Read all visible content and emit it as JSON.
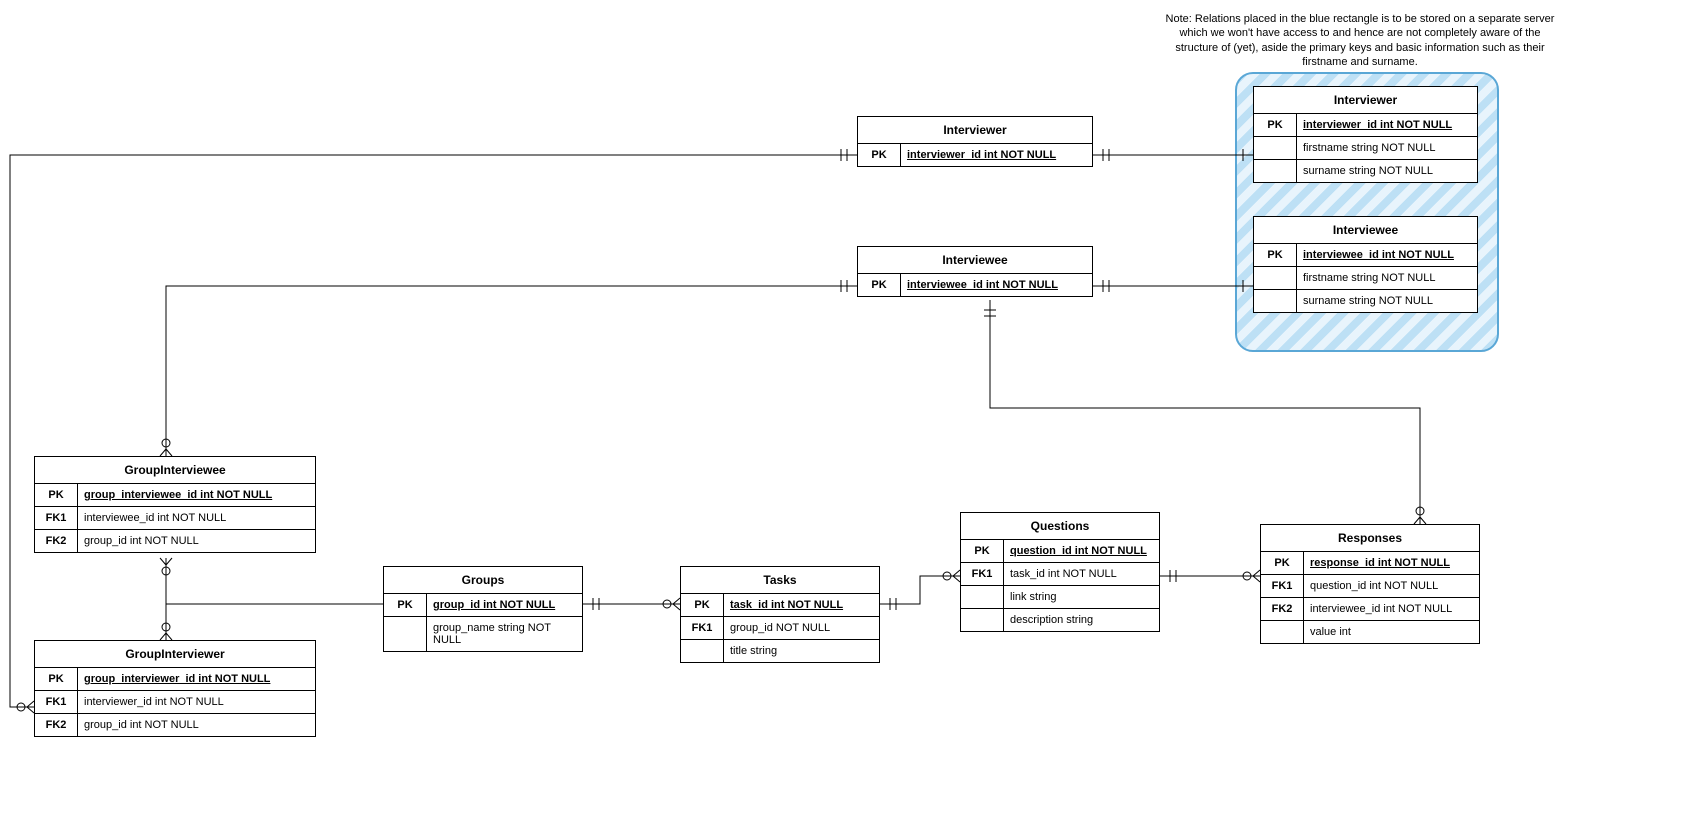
{
  "note": {
    "line1": "Note: Relations placed in the blue rectangle is to be stored on a separate server",
    "line2": "which we won't have access to and hence are not completely aware of the",
    "line3": "structure of (yet), aside the primary keys and basic information such as their",
    "line4": "firstname and surname."
  },
  "entities": {
    "blue_interviewer": {
      "title": "Interviewer",
      "rows": [
        {
          "key": "PK",
          "val": "interviewer_id int NOT NULL",
          "pk": true
        },
        {
          "key": "",
          "val": "firstname string NOT NULL"
        },
        {
          "key": "",
          "val": "surname string NOT NULL"
        }
      ]
    },
    "blue_interviewee": {
      "title": "Interviewee",
      "rows": [
        {
          "key": "PK",
          "val": "interviewee_id int NOT NULL",
          "pk": true
        },
        {
          "key": "",
          "val": "firstname string NOT NULL"
        },
        {
          "key": "",
          "val": "surname string NOT NULL"
        }
      ]
    },
    "interviewer": {
      "title": "Interviewer",
      "rows": [
        {
          "key": "PK",
          "val": "interviewer_id int NOT NULL",
          "pk": true
        }
      ]
    },
    "interviewee": {
      "title": "Interviewee",
      "rows": [
        {
          "key": "PK",
          "val": "interviewee_id int NOT NULL",
          "pk": true
        }
      ]
    },
    "group_interviewee": {
      "title": "GroupInterviewee",
      "rows": [
        {
          "key": "PK",
          "val": "group_interviewee_id int NOT NULL",
          "pk": true
        },
        {
          "key": "FK1",
          "val": "interviewee_id int NOT NULL"
        },
        {
          "key": "FK2",
          "val": "group_id int NOT NULL"
        }
      ]
    },
    "group_interviewer": {
      "title": "GroupInterviewer",
      "rows": [
        {
          "key": "PK",
          "val": "group_interviewer_id int NOT NULL",
          "pk": true
        },
        {
          "key": "FK1",
          "val": "interviewer_id int NOT NULL"
        },
        {
          "key": "FK2",
          "val": "group_id int NOT NULL"
        }
      ]
    },
    "groups": {
      "title": "Groups",
      "rows": [
        {
          "key": "PK",
          "val": "group_id int NOT NULL",
          "pk": true
        },
        {
          "key": "",
          "val": "group_name string NOT NULL"
        }
      ]
    },
    "tasks": {
      "title": "Tasks",
      "rows": [
        {
          "key": "PK",
          "val": "task_id int NOT NULL",
          "pk": true
        },
        {
          "key": "FK1",
          "val": "group_id NOT NULL"
        },
        {
          "key": "",
          "val": "title string"
        }
      ]
    },
    "questions": {
      "title": "Questions",
      "rows": [
        {
          "key": "PK",
          "val": "question_id int NOT NULL",
          "pk": true
        },
        {
          "key": "FK1",
          "val": "task_id int NOT NULL"
        },
        {
          "key": "",
          "val": "link string"
        },
        {
          "key": "",
          "val": "description string"
        }
      ]
    },
    "responses": {
      "title": "Responses",
      "rows": [
        {
          "key": "PK",
          "val": "response_id int NOT NULL",
          "pk": true
        },
        {
          "key": "FK1",
          "val": "question_id int NOT NULL"
        },
        {
          "key": "FK2",
          "val": "interviewee_id int NOT NULL"
        },
        {
          "key": "",
          "val": "value int"
        }
      ]
    }
  }
}
